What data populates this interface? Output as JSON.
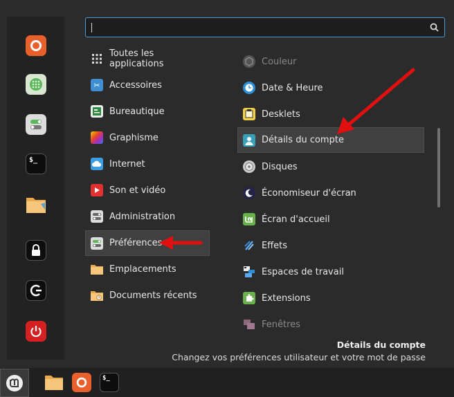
{
  "search": {
    "value": "",
    "placeholder": ""
  },
  "categories": [
    {
      "label": "Toutes les applications",
      "icon": "grid-icon"
    },
    {
      "label": "Accessoires",
      "icon": "scissors-icon"
    },
    {
      "label": "Bureautique",
      "icon": "office-icon"
    },
    {
      "label": "Graphisme",
      "icon": "graphics-icon"
    },
    {
      "label": "Internet",
      "icon": "cloud-icon"
    },
    {
      "label": "Son et vidéo",
      "icon": "play-icon"
    },
    {
      "label": "Administration",
      "icon": "admin-toggle-icon"
    },
    {
      "label": "Préférences",
      "icon": "preferences-toggle-icon",
      "selected": true
    },
    {
      "label": "Emplacements",
      "icon": "folder-icon"
    },
    {
      "label": "Documents récents",
      "icon": "recent-folder-icon"
    }
  ],
  "apps": [
    {
      "label": "Couleur",
      "icon": "color-icon",
      "dimmed": true
    },
    {
      "label": "Date & Heure",
      "icon": "clock-icon"
    },
    {
      "label": "Desklets",
      "icon": "desklets-icon"
    },
    {
      "label": "Détails du compte",
      "icon": "account-icon",
      "selected": true
    },
    {
      "label": "Disques",
      "icon": "disk-icon"
    },
    {
      "label": "Économiseur d'écran",
      "icon": "screensaver-icon"
    },
    {
      "label": "Écran d'accueil",
      "icon": "login-screen-icon"
    },
    {
      "label": "Effets",
      "icon": "effects-icon"
    },
    {
      "label": "Espaces de travail",
      "icon": "workspaces-icon"
    },
    {
      "label": "Extensions",
      "icon": "extensions-icon"
    },
    {
      "label": "Fenêtres",
      "icon": "windows-icon",
      "dimmed": true
    }
  ],
  "description": {
    "title": "Détails du compte",
    "text": "Changez vos préférences utilisateur et votre mot de passe"
  },
  "favorites": [
    "firefox-icon",
    "calculator-icon",
    "settings-toggle-icon",
    "terminal-icon",
    "files-icon",
    "lock-icon",
    "logout-icon",
    "power-icon"
  ],
  "taskbar": [
    "mint-menu-icon",
    "files-icon",
    "firefox-icon",
    "terminal-icon"
  ],
  "colors": {
    "accent": "#4a9fd6",
    "arrow": "#e01010",
    "background": "#2b2b2b"
  },
  "terminal_prompt": "$_"
}
